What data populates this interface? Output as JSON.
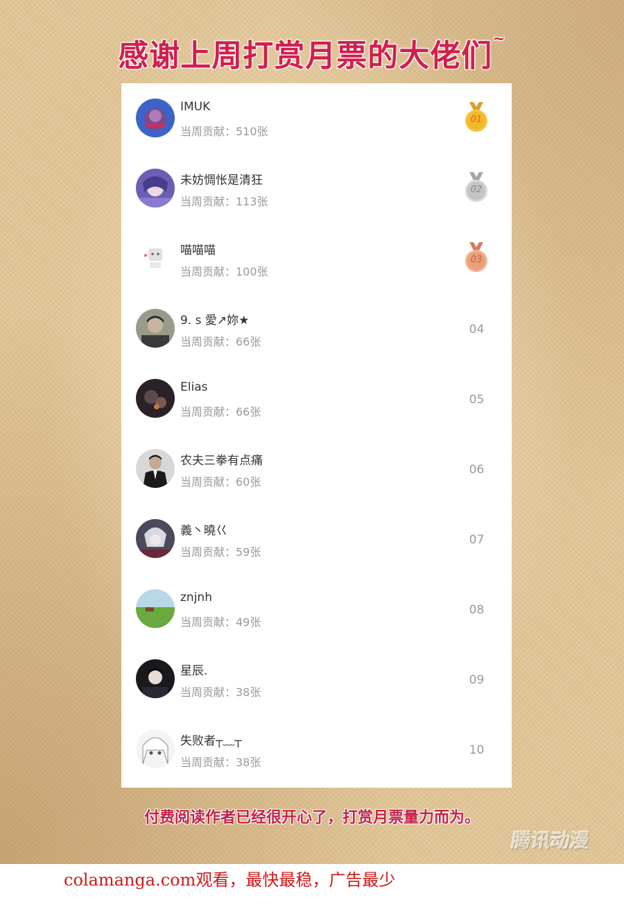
{
  "header": {
    "title": "感谢上周打赏月票的大佬们",
    "title_suffix": "~"
  },
  "colors": {
    "title": "#d11f4e",
    "gold": "#f0b92c",
    "silver": "#c4c4c4",
    "bronze": "#e8a07a"
  },
  "leaderboard": [
    {
      "name": "IMUK",
      "contribution": "当周贡献：510张",
      "rank": "01",
      "medal": "gold"
    },
    {
      "name": "未妨惆怅是清狂",
      "contribution": "当周贡献：113张",
      "rank": "02",
      "medal": "silver"
    },
    {
      "name": "喵喵喵",
      "contribution": "当周贡献：100张",
      "rank": "03",
      "medal": "bronze"
    },
    {
      "name": "9. s 愛↗妳★",
      "contribution": "当周贡献：66张",
      "rank": "04"
    },
    {
      "name": "Elias",
      "contribution": "当周贡献：66张",
      "rank": "05"
    },
    {
      "name": "农夫三拳有点痛",
      "contribution": "当周贡献：60张",
      "rank": "06"
    },
    {
      "name": "義丶曉巜",
      "contribution": "当周贡献：59张",
      "rank": "07"
    },
    {
      "name": "znjnh",
      "contribution": "当周贡献：49张",
      "rank": "08"
    },
    {
      "name": "星辰.",
      "contribution": "当周贡献：38张",
      "rank": "09"
    },
    {
      "name": "失败者┬﹏┬",
      "contribution": "当周贡献：38张",
      "rank": "10"
    }
  ],
  "footer": {
    "text": "付费阅读作者已经很开心了，打赏月票量力而为。",
    "logo": "腾讯动漫"
  },
  "watermark": "colamanga.com观看，最快最稳，广告最少"
}
